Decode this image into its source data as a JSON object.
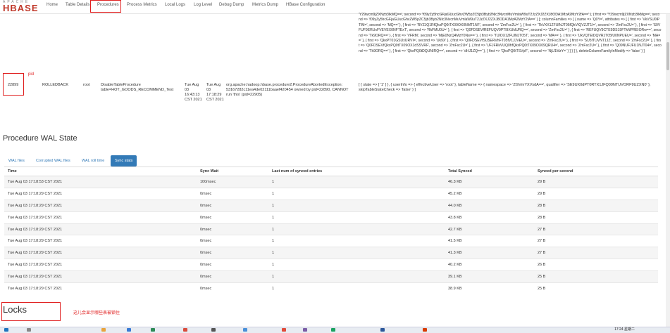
{
  "app": {
    "logo_top": "APACHE",
    "logo_main": "HBASE"
  },
  "nav": {
    "home": "Home",
    "table_details": "Table Details",
    "procedures": "Procedures",
    "process_metrics": "Process Metrics",
    "local_logs": "Local Logs",
    "log_level": "Log Level",
    "debug_dump": "Debug Dump",
    "metrics_dump": "Metrics Dump",
    "hbase_configuration": "HBase Configuration"
  },
  "procedure_params_text": "'Y29wcm9jZXNzb3IkMQ==', second => 'f09yZy5hcGFjaGUucGhvZW5pZC5jb3Byb2Nlc3NvcnMuVmlaW9uT2JzZXJ2ZXJ8ODA1MzA2MzY2fA==' }, { first => 'Y29wcm9jZXNzb3IkMg==', second => 'f09yZy5hcGFjaGUucGhvZW5pZC5jb3Byb2Nlc3NvcnMuVmlaW9uT2JzZXJ2ZXJ8ODA1MzA2MzY2fA==' } ]; columnFamilies => [ { name => 'Q0Y=', attributes => [ { first => 'VkVSU0lPTlM=', second => 'MQ==' }, { first => 'RVZJQ1RfQkxPQ0tTX09OX0NMT1NF', second => 'ZmFsc2U=' }, { first => 'TkVXX1ZFUlNJT05fQkVIQVZJT1I=', second => 'ZmFsc2U=' }, { first => 'S0VFUF9ERUxFVEVEX0NFTExT', second => 'RkFMU0U=' }, { first => 'Q0FDSEVfREFUQV9PTl9XUklURQ==', second => 'ZmFsc2U=' }, { first => 'REFUQV9CTE9DS19FTkNPREIORw==', second => 'Tk9ORQ==' }, { first => 'VFRM', second => 'MjE0NzQ4MzY0Nw==' }, { first => 'TUlOX1ZFUlNJT05T', second => 'MA==' }, { first => 'UkVQTElDQVRJT05fU0NPUEU=', second => 'MA==' }, { first => 'QkxPT01GSUxURVI=', second => 'Uk9X' }, { first => 'Q0FDSEVfSU5ERVhFT05fV1JJVEU=', second => 'ZmFsc2U=' }, { first => 'SU5fTUVNT1JZ', second => 'ZmFsc2U=' }, { first => 'Q0FDSEVfQkxPQ0tTX09OX1dSSVRF', second => 'ZmFsc2U=' }, { first => 'UFJFRkVUQ0hfQkxPQ0tTX09OX09QRU4=', second => 'ZmFsc2U=' }, { first => 'Q09NUFJFU1NJT04=', second => 'Tk9ORQ==' }, { first => 'QkxPQ0tDQUNIRQ==', second => 'dHJ1ZQ==' }, { first => 'QkxPQ0tTSVpF', second => 'NjU1MzY=' } ] } ] }, deleteColumnFamilyInModify => 'false' } ]",
  "procedure_row": {
    "pid": "22899",
    "state": "ROLLEDBACK",
    "owner": "root",
    "type": "DisableTableProcedure table=HOT_GOODS_RECOMMEND_Test",
    "start_time": "Tue Aug 03 16:43:13 CST 2021",
    "last_update": "Tue Aug 03 17:18:29 CST 2021",
    "errors": "org.apache.hadoop.hbase.procedure2.ProcedureAbortedException: 53167282c11ea4de02111baaef420454 owned by pid=22890, CANNOT run 'this' (pid=22905)",
    "parameters": "[ { state => [ '1' ] }, { userInfo => { effectiveUser => 'root' }, tableName => { namespace => 'ZGVmYXVsdA==', qualifier => 'SE9UX0dPT0RTX1JFQ09NTUVORF9UZXN0' }, skipTableStateCheck => 'false' } ]"
  },
  "annotations": {
    "pid_note": "pid",
    "locks_note": "这儿会显示哪些表被锁住"
  },
  "wal": {
    "title": "Procedure WAL State",
    "tabs": [
      "WAL files",
      "Corrupted WAL files",
      "WAL roll time",
      "Sync stats"
    ],
    "columns": [
      "Time",
      "Sync Wait",
      "Last num of synced entries",
      "Total Synced",
      "Synced per second"
    ],
    "rows": [
      [
        "Tue Aug 03 17:18:53 CST 2021",
        "100msec",
        "1",
        "46.3 KB",
        "29 B"
      ],
      [
        "Tue Aug 03 17:18:29 CST 2021",
        "0msec",
        "1",
        "45.2 KB",
        "29 B"
      ],
      [
        "Tue Aug 03 17:18:29 CST 2021",
        "0msec",
        "1",
        "44.0 KB",
        "28 B"
      ],
      [
        "Tue Aug 03 17:18:29 CST 2021",
        "0msec",
        "1",
        "43.8 KB",
        "28 B"
      ],
      [
        "Tue Aug 03 17:18:29 CST 2021",
        "0msec",
        "1",
        "42.7 KB",
        "27 B"
      ],
      [
        "Tue Aug 03 17:18:29 CST 2021",
        "0msec",
        "1",
        "41.5 KB",
        "27 B"
      ],
      [
        "Tue Aug 03 17:18:29 CST 2021",
        "0msec",
        "1",
        "41.3 KB",
        "27 B"
      ],
      [
        "Tue Aug 03 17:18:29 CST 2021",
        "0msec",
        "1",
        "40.2 KB",
        "26 B"
      ],
      [
        "Tue Aug 03 17:18:29 CST 2021",
        "0msec",
        "1",
        "39.1 KB",
        "25 B"
      ],
      [
        "Tue Aug 03 17:18:29 CST 2021",
        "0msec",
        "1",
        "38.9 KB",
        "25 B"
      ]
    ]
  },
  "locks": {
    "title": "Locks"
  },
  "taskbar": {
    "time": "17:24 星期二"
  }
}
